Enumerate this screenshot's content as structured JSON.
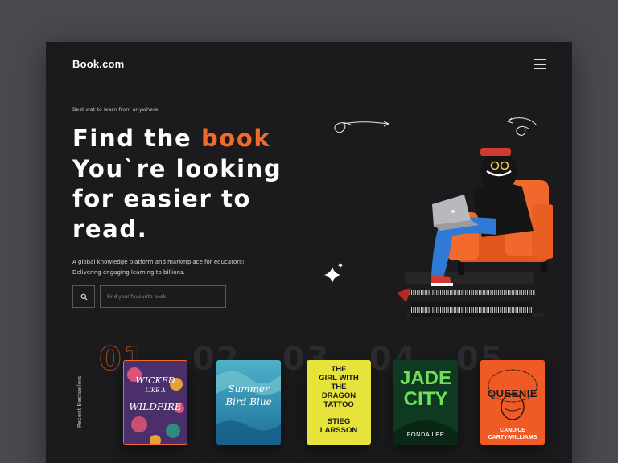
{
  "header": {
    "logo": "Book.com"
  },
  "hero": {
    "tagline": "Best wat to learn from anywhere",
    "headline": {
      "line1_a": "Find the ",
      "line1_accent": "book",
      "line2": "You`re looking",
      "line3": "for easier to",
      "line4": "read."
    },
    "description": "A global knowledge platform and marketplace for educators! Delivering engaging learning to billions.",
    "search": {
      "placeholder": "Find your favourite book"
    }
  },
  "bestsellers": {
    "label": "Recent Bestsellers",
    "books": [
      {
        "number": "01",
        "title_lines": [
          "WICKED",
          "LIKE A",
          "WILDFIRE"
        ]
      },
      {
        "number": "02",
        "title_lines": [
          "Summer",
          "Bird Blue"
        ]
      },
      {
        "number": "03",
        "title_lines": [
          "THE",
          "GIRL WITH",
          "THE",
          "DRAGON",
          "TATTOO"
        ],
        "author_lines": [
          "STIEG",
          "LARSSON"
        ]
      },
      {
        "number": "04",
        "title_lines": [
          "JADE",
          "CITY"
        ],
        "author": "FONDA LEE"
      },
      {
        "number": "05",
        "title": "QUEENIE",
        "author_lines": [
          "CANDICE",
          "CARTY-WILLIAMS"
        ]
      }
    ]
  },
  "colors": {
    "accent": "#f36a2c",
    "background": "#1b1b1d",
    "outer": "#4a494e"
  },
  "icons": [
    "menu-icon",
    "search-icon",
    "sparkle-icon",
    "arrow-doodle-icon"
  ]
}
